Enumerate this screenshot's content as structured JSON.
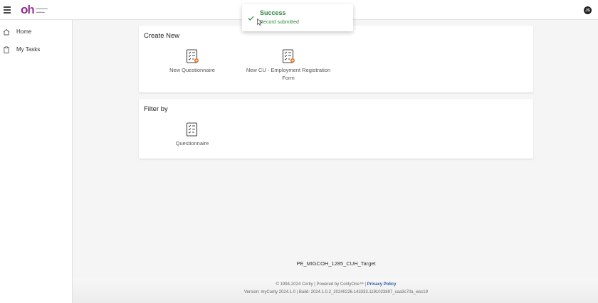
{
  "header": {
    "avatar_initials": "JS"
  },
  "sidebar": {
    "items": [
      {
        "label": "Home",
        "icon": "home-icon"
      },
      {
        "label": "My Tasks",
        "icon": "clipboard-icon"
      }
    ]
  },
  "create_new": {
    "title": "Create New",
    "tiles": [
      {
        "label": "New Questionnaire",
        "icon": "new-questionnaire-icon"
      },
      {
        "label": "New CU - Employment Registration Form",
        "icon": "new-form-icon"
      }
    ]
  },
  "filter_by": {
    "title": "Filter by",
    "tiles": [
      {
        "label": "Questionnaire",
        "icon": "questionnaire-icon"
      }
    ]
  },
  "environment": "PE_MIGCOH_1285_CUH_Target",
  "footer": {
    "copyright": "© 1994-2024 Cority | Powered by CorityOne™ |",
    "privacy_link": "Privacy Policy",
    "version": "Version: myCority 2024.1.0 | Build: 2024.1.0.2_20240226.143333.1191023897_caa3c70a_wsc19"
  },
  "toast": {
    "title": "Success",
    "message": "Record submitted",
    "status_color": "#2e8b3e"
  },
  "colors": {
    "brand": "#8a2a8a",
    "link": "#2c5aa0"
  }
}
